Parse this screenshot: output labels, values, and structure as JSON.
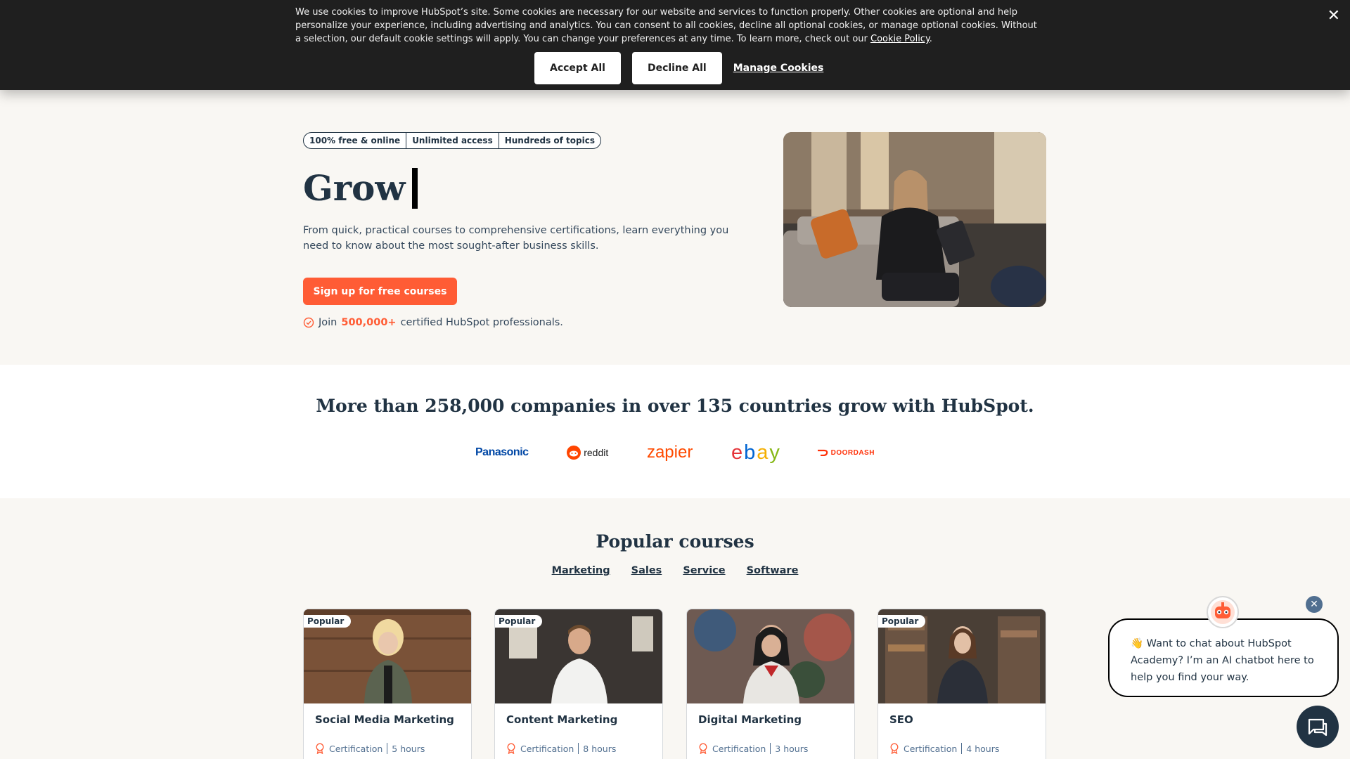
{
  "cookie_banner": {
    "text": "We use cookies to improve HubSpot’s site. Some cookies are necessary for our website and services to function properly. Other cookies are optional and help personalize your experience, including advertising and analytics. You can consent to all cookies, decline all optional cookies, or manage optional cookies. Without a selection, our default cookie settings will apply. You can change your preferences at any time. To learn more, check out our",
    "policy_link": "Cookie Policy",
    "policy_suffix": ".",
    "accept_label": "Accept All",
    "decline_label": "Decline All",
    "manage_label": "Manage Cookies",
    "close_symbol": "✕"
  },
  "hero": {
    "badges": [
      "100% free & online",
      "Unlimited access",
      "Hundreds of topics"
    ],
    "title": "Grow",
    "description": "From quick, practical courses to comprehensive certifications, learn everything you need to know about the most sought-after business skills.",
    "cta_label": "Sign up for free courses",
    "join_prefix": "Join",
    "join_count": "500,000+",
    "join_suffix": "certified HubSpot professionals."
  },
  "trust": {
    "title": "More than 258,000 companies in over 135 countries grow with HubSpot.",
    "logos": {
      "panasonic": "Panasonic",
      "reddit": "reddit",
      "zapier": "zapier",
      "doordash": "DOORDASH"
    }
  },
  "courses": {
    "title": "Popular courses",
    "tabs": [
      "Marketing",
      "Sales",
      "Service",
      "Software"
    ],
    "cards": [
      {
        "badge": "Popular",
        "title": "Social Media Marketing",
        "type": "Certification",
        "duration": "5 hours"
      },
      {
        "badge": "Popular",
        "title": "Content Marketing",
        "type": "Certification",
        "duration": "8 hours"
      },
      {
        "badge": "",
        "title": "Digital Marketing",
        "type": "Certification",
        "duration": "3 hours"
      },
      {
        "badge": "Popular",
        "title": "SEO",
        "type": "Certification",
        "duration": "4 hours"
      }
    ]
  },
  "chat": {
    "message": "👋 Want to chat about HubSpot Academy? I’m an AI chatbot here to help you find your way.",
    "close_symbol": "✕"
  },
  "colors": {
    "accent": "#ff5c35",
    "navy": "#213343",
    "banner_bg": "#1f1f1f",
    "hero_bg": "#f9f7f3"
  }
}
